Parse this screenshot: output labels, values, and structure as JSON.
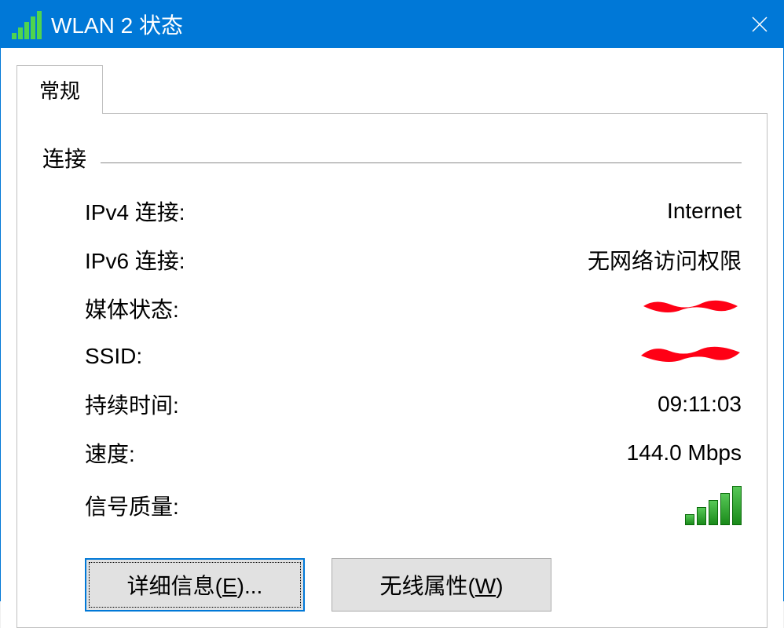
{
  "titlebar": {
    "title": "WLAN 2 状态"
  },
  "tabs": {
    "general": "常规"
  },
  "section": {
    "connection": "连接"
  },
  "properties": {
    "ipv4": {
      "label": "IPv4 连接:",
      "value": "Internet"
    },
    "ipv6": {
      "label": "IPv6 连接:",
      "value": "无网络访问权限"
    },
    "media_state": {
      "label": "媒体状态:",
      "value": "[redacted]"
    },
    "ssid": {
      "label": "SSID:",
      "value": "[redacted]"
    },
    "duration": {
      "label": "持续时间:",
      "value": "09:11:03"
    },
    "speed": {
      "label": "速度:",
      "value": "144.0 Mbps"
    },
    "signal_quality": {
      "label": "信号质量:"
    }
  },
  "buttons": {
    "details_prefix": "详细信息(",
    "details_hotkey": "E",
    "details_suffix": ")...",
    "wireless_prefix": "无线属性(",
    "wireless_hotkey": "W",
    "wireless_suffix": ")"
  }
}
